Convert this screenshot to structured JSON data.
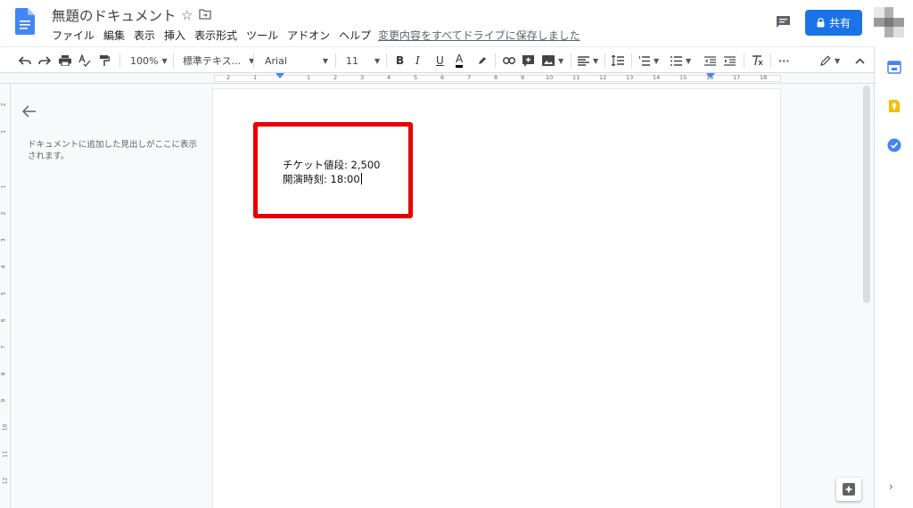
{
  "header": {
    "doc_title": "無題のドキュメント",
    "star_icon": "☆",
    "menu": [
      "ファイル",
      "編集",
      "表示",
      "挿入",
      "表示形式",
      "ツール",
      "アドオン",
      "ヘルプ"
    ],
    "saved_status": "変更内容をすべてドライブに保存しました",
    "share_label": "共有",
    "share_color": "#1a73e8"
  },
  "toolbar": {
    "zoom": "100%",
    "style": "標準テキス...",
    "font": "Arial",
    "font_size": "11",
    "bold": "B",
    "italic": "I",
    "underline": "U",
    "text_color": "A",
    "more": "···"
  },
  "ruler": {
    "labels": [
      "2",
      "1",
      "1",
      "2",
      "3",
      "4",
      "5",
      "6",
      "7",
      "8",
      "9",
      "10",
      "11",
      "12",
      "13",
      "14",
      "15",
      "16",
      "17",
      "18"
    ],
    "vertical_labels": [
      "2",
      "1",
      "1",
      "2",
      "3",
      "4",
      "5",
      "6",
      "7",
      "8",
      "9",
      "10",
      "11",
      "12",
      "13"
    ]
  },
  "outline": {
    "hint": "ドキュメントに追加した見出しがここに表示されます。"
  },
  "document": {
    "line1": "チケット値段: 2,500",
    "line2": "開演時刻: 18:00",
    "highlight_color": "#e60000"
  },
  "side_panel": {
    "icons": [
      "calendar-icon",
      "keep-icon",
      "tasks-icon"
    ],
    "chevron": "›"
  }
}
